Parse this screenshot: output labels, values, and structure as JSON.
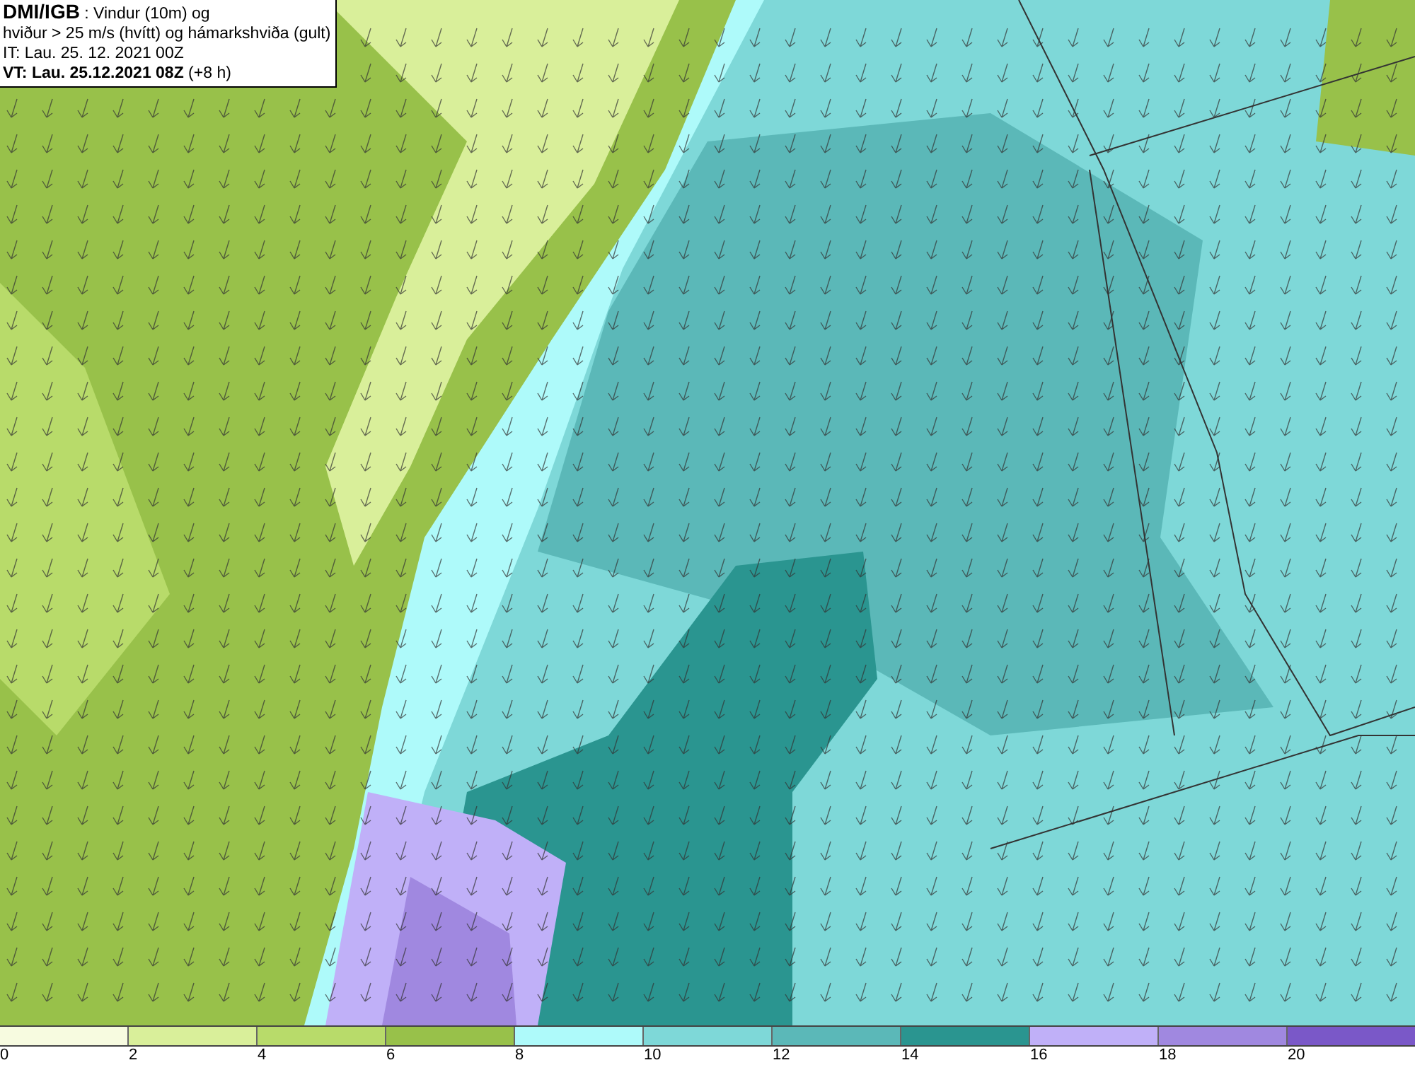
{
  "header": {
    "lines": [
      "**DMI/IGB** : Vindur (10m) og",
      "hviður > 25 m/s (hvítt) og hámarkshviða (gult)",
      "IT: Lau. 25. 12. 2021 00Z",
      "**VT: Lau. 25.12.2021 08Z** (+8 h)"
    ]
  },
  "legend": {
    "segments": [
      {
        "color": "#f7fbe0"
      },
      {
        "color": "#d9ef9a"
      },
      {
        "color": "#b8db6a"
      },
      {
        "color": "#98c14a"
      },
      {
        "color": "#aefafa"
      },
      {
        "color": "#7ed8d8"
      },
      {
        "color": "#5bb8b8"
      },
      {
        "color": "#2a9590"
      },
      {
        "color": "#c0b0f8"
      },
      {
        "color": "#a088e0"
      },
      {
        "color": "#7a58c8"
      }
    ],
    "labels": [
      "0",
      "2",
      "4",
      "6",
      "8",
      "10",
      "12",
      "14",
      "16",
      "18",
      "20"
    ]
  }
}
